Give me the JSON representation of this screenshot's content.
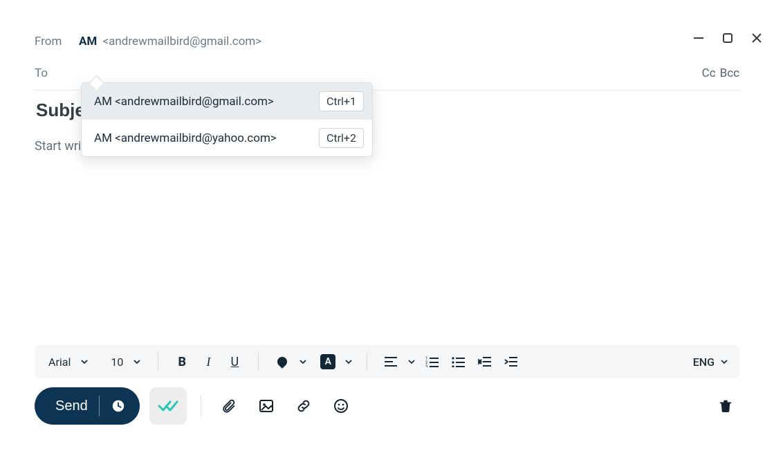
{
  "window": {
    "minimize": "—",
    "maximize": "▢",
    "close": "✕"
  },
  "compose": {
    "from_label": "From",
    "from_initials": "AM",
    "from_email": "<andrewmailbird@gmail.com>",
    "to_label": "To",
    "to_value": "",
    "cc_label": "Cc",
    "bcc_label": "Bcc",
    "subject_placeholder": "Subject",
    "body_placeholder": "Start writing"
  },
  "account_dropdown": {
    "items": [
      {
        "label": "AM <andrewmailbird@gmail.com>",
        "shortcut": "Ctrl+1",
        "selected": true
      },
      {
        "label": "AM <andrewmailbird@yahoo.com>",
        "shortcut": "Ctrl+2",
        "selected": false
      }
    ]
  },
  "toolbar": {
    "font_family": "Arial",
    "font_size": "10",
    "bold": "B",
    "italic": "I",
    "underline": "U",
    "highlight_letter": "A",
    "language": "ENG"
  },
  "actions": {
    "send_label": "Send"
  }
}
